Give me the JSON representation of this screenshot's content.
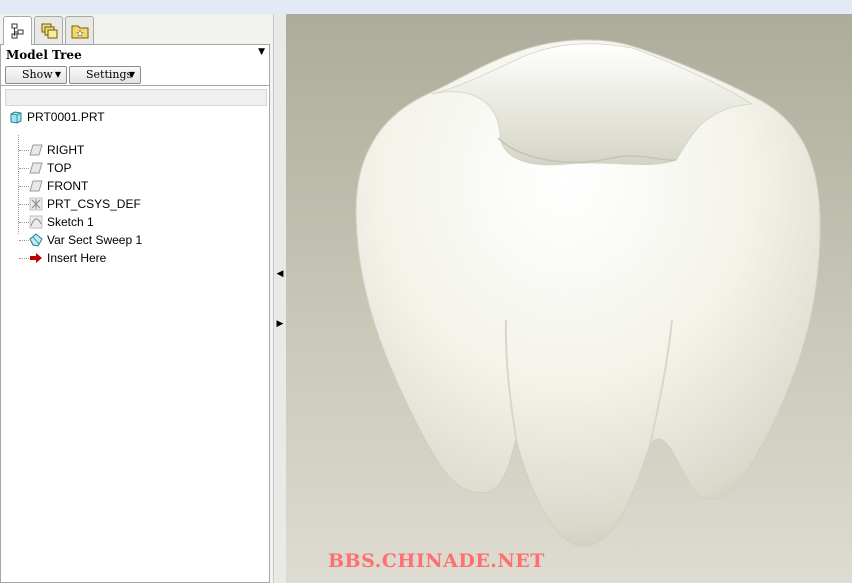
{
  "tabs": [
    {
      "icon": "model-tree-icon",
      "active": true
    },
    {
      "icon": "layers-icon",
      "active": false
    },
    {
      "icon": "favorites-folder-icon",
      "active": false
    }
  ],
  "model_tree": {
    "title": "Model Tree",
    "menu_icon": "dropdown-triangle-icon",
    "show_label": "Show",
    "settings_label": "Settings",
    "nodes": [
      {
        "label": "PRT0001.PRT",
        "icon": "part-icon"
      },
      {
        "label": "RIGHT",
        "icon": "datum-plane-icon"
      },
      {
        "label": "TOP",
        "icon": "datum-plane-icon"
      },
      {
        "label": "FRONT",
        "icon": "datum-plane-icon"
      },
      {
        "label": "PRT_CSYS_DEF",
        "icon": "coordinate-system-icon"
      },
      {
        "label": "Sketch 1",
        "icon": "sketch-icon"
      },
      {
        "label": "Var Sect Sweep 1",
        "icon": "sweep-feature-icon"
      },
      {
        "label": "Insert Here",
        "icon": "insert-arrow-icon"
      }
    ]
  },
  "viewport": {
    "model": "tooth-3d-model",
    "watermark": "BBS.CHINADE.NET"
  },
  "colors": {
    "model_surface": "#f3f3ea",
    "background_top": "#adac9a",
    "background_bottom": "#dedcd1",
    "watermark": "#ff6f6f",
    "insert_arrow": "#c00000"
  }
}
